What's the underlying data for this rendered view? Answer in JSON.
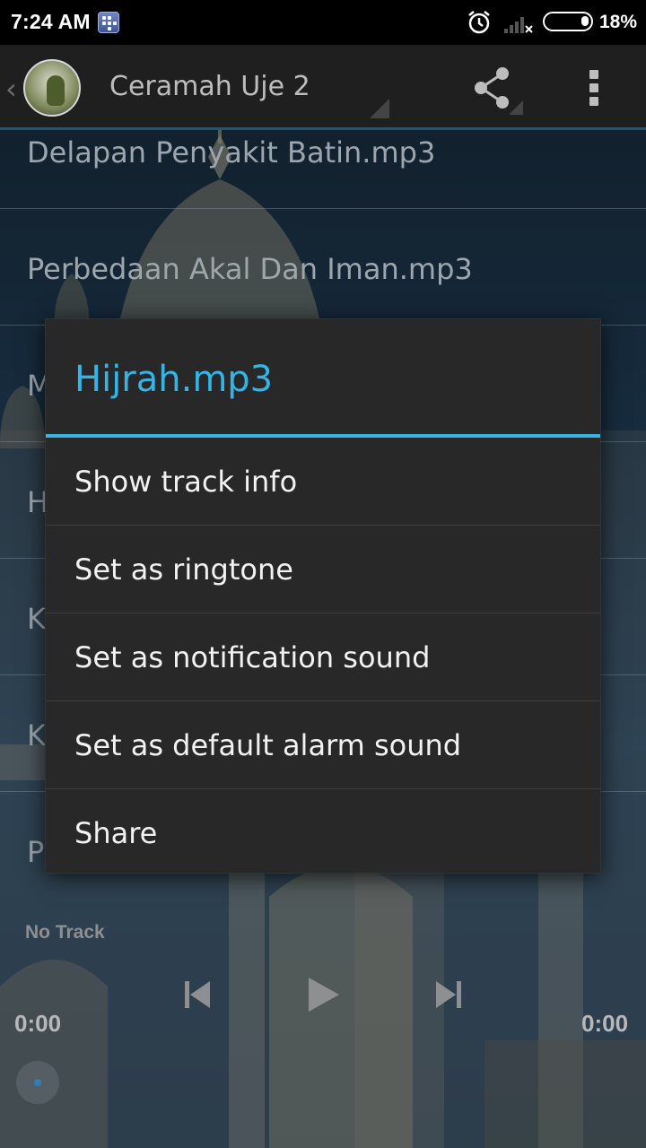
{
  "status_bar": {
    "time": "7:24 AM",
    "battery_percent": "18%",
    "battery_level": 0.18,
    "icons": [
      "bbm-icon",
      "alarm-icon",
      "signal-icon",
      "battery-icon"
    ]
  },
  "action_bar": {
    "title": "Ceramah Uje 2",
    "icons": [
      "back-icon",
      "app-logo",
      "share-icon",
      "overflow-menu-icon"
    ]
  },
  "tracks": [
    "Delapan Penyakit Batin.mp3",
    "Perbedaan Akal Dan Iman.mp3",
    "M",
    "H",
    "K",
    "K",
    "P"
  ],
  "player": {
    "status": "No Track",
    "elapsed": "0:00",
    "duration": "0:00",
    "controls": [
      "previous-icon",
      "play-icon",
      "next-icon"
    ]
  },
  "dialog": {
    "title": "Hijrah.mp3",
    "items": [
      "Show track info",
      "Set as ringtone",
      "Set as notification sound",
      "Set as default alarm sound",
      "Share"
    ]
  },
  "colors": {
    "accent": "#33b5e5",
    "dialog_bg": "#282828",
    "actionbar_bg": "#1f1f1f",
    "actionbar_border": "#2c5168"
  }
}
